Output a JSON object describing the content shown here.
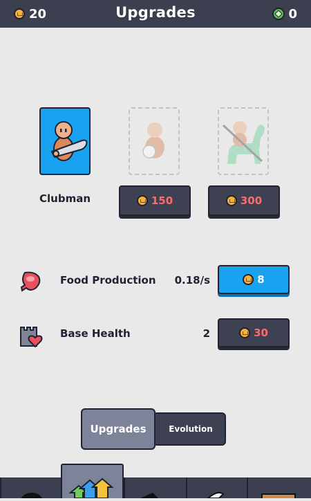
{
  "header": {
    "title": "Upgrades",
    "coins": "20",
    "gems": "0"
  },
  "units": [
    {
      "name": "Clubman",
      "state": "owned"
    },
    {
      "state": "locked",
      "price": "150"
    },
    {
      "state": "locked",
      "price": "300"
    }
  ],
  "upgrades": [
    {
      "label": "Food Production",
      "value": "0.18/s",
      "price": "8",
      "icon": "meat-icon",
      "button_style": "blue"
    },
    {
      "label": "Base Health",
      "value": "2",
      "price": "30",
      "icon": "castle-heart-icon",
      "button_style": "dark"
    }
  ],
  "tabs": [
    {
      "label": "Upgrades",
      "selected": true
    },
    {
      "label": "Evolution",
      "selected": false
    }
  ],
  "colors": {
    "topbar": "#3b3f4f",
    "accent_blue": "#18a2f0",
    "price_red": "#ff6b6b",
    "coin": "#f4b43c",
    "gem": "#5bbf4e"
  }
}
